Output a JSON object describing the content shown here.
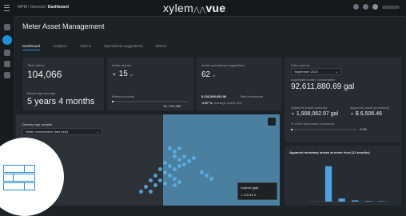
{
  "header": {
    "breadcrumb_prefix": "MPM / General /",
    "breadcrumb_current": "Dashboard",
    "brand_left": "xylem",
    "brand_right": "vue"
  },
  "page": {
    "title": "Meter Asset Management"
  },
  "tabs": [
    {
      "label": "Dashboard",
      "active": true
    },
    {
      "label": "Analytics",
      "active": false
    },
    {
      "label": "Alarms",
      "active": false
    },
    {
      "label": "Operational suggestions",
      "active": false
    },
    {
      "label": "Meters",
      "active": false
    }
  ],
  "cards": {
    "total_meters": {
      "label": "Total meters",
      "value": "104,066",
      "age_label": "Meters age average",
      "age_value": "5 years 4 months"
    },
    "active_alarms": {
      "label": "Active alarms",
      "value": "15",
      "trend": "▼",
      "unit": "of",
      "sub_label": "Meters involved",
      "sub_value": "15 / 104,066",
      "fill_percent": 0.02
    },
    "suggestions": {
      "label": "Active operational suggestions",
      "value": "62",
      "unit": "of",
      "investment_value": "$ 136,569,052.96",
      "investment_label": "Total investment",
      "roi_value": "-0.97 %",
      "roi_label": "Average yearly ROI"
    },
    "consumption": {
      "period_label": "Data used for",
      "period_value": "September 2023",
      "aggregated_label": "Aggregated water consumption",
      "aggregated_value": "92,611,880.69 gal",
      "volume_label": "Apparent losses (volume)",
      "volume_value": "1,908,062.97 gal",
      "monetary_label": "Apparent losses (monetary)",
      "monetary_value": "$ 6,506.46",
      "percent_label": "% of the total water consumed",
      "percent_value": "2.0%"
    }
  },
  "map": {
    "variable_label": "Density map variable",
    "variable_value": "Water consumption (last year)",
    "legend_label": "Legend (gal)",
    "legend_value": "< 125.49 K"
  },
  "chart_data": {
    "type": "bar",
    "title": "Apparent monetary losses at meter level (12 months)",
    "categories": [
      "b1",
      "b2",
      "b3",
      "b4",
      "b5",
      "b6"
    ],
    "values": [
      0,
      170,
      15,
      6,
      3,
      2
    ],
    "ylim": [
      0,
      200
    ]
  }
}
